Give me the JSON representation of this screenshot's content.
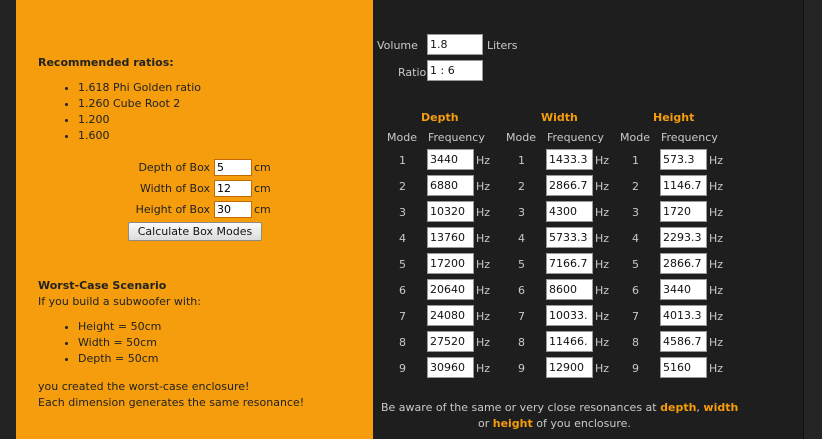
{
  "left": {
    "recommended_title": "Recommended ratios:",
    "ratios": [
      "1.618 Phi Golden ratio",
      "1.260 Cube Root 2",
      "1.200",
      "1.600"
    ],
    "depth_label": "Depth of Box",
    "depth_value": "5",
    "width_label": "Width of Box",
    "width_value": "12",
    "height_label": "Height of Box",
    "height_value": "30",
    "unit": "cm",
    "calc_button": "Calculate Box Modes",
    "worst_title": "Worst-Case Scenario",
    "worst_subtitle": "If you build a subwoofer with:",
    "worst_items": [
      "Height = 50cm",
      "Width = 50cm",
      "Depth = 50cm"
    ],
    "worst_conclusion_1": "you created the worst-case enclosure!",
    "worst_conclusion_2": "Each dimension generates the same resonance!"
  },
  "right": {
    "volume_label": "Volume",
    "volume_value": "1.8",
    "volume_unit": "Liters",
    "ratio_label": "Ratio",
    "ratio_value": "1 : 6",
    "mode_header": "Mode",
    "freq_header": "Frequency",
    "hz_unit": "Hz",
    "columns": [
      {
        "title": "Depth",
        "freqs": [
          "3440",
          "6880",
          "10320",
          "13760",
          "17200",
          "20640",
          "24080",
          "27520",
          "30960"
        ]
      },
      {
        "title": "Width",
        "freqs": [
          "1433.3",
          "2866.7",
          "4300",
          "5733.3",
          "7166.7",
          "8600",
          "10033.",
          "11466.",
          "12900"
        ]
      },
      {
        "title": "Height",
        "freqs": [
          "573.3",
          "1146.7",
          "1720",
          "2293.3",
          "2866.7",
          "3440",
          "4013.3",
          "4586.7",
          "5160"
        ]
      }
    ],
    "modes": [
      "1",
      "2",
      "3",
      "4",
      "5",
      "6",
      "7",
      "8",
      "9"
    ],
    "note_part1": "Be aware of the same or very close resonances at ",
    "note_depth": "depth",
    "note_comma": ", ",
    "note_width": "width",
    "note_or": "or ",
    "note_height": "height",
    "note_end": " of you enclosure."
  }
}
